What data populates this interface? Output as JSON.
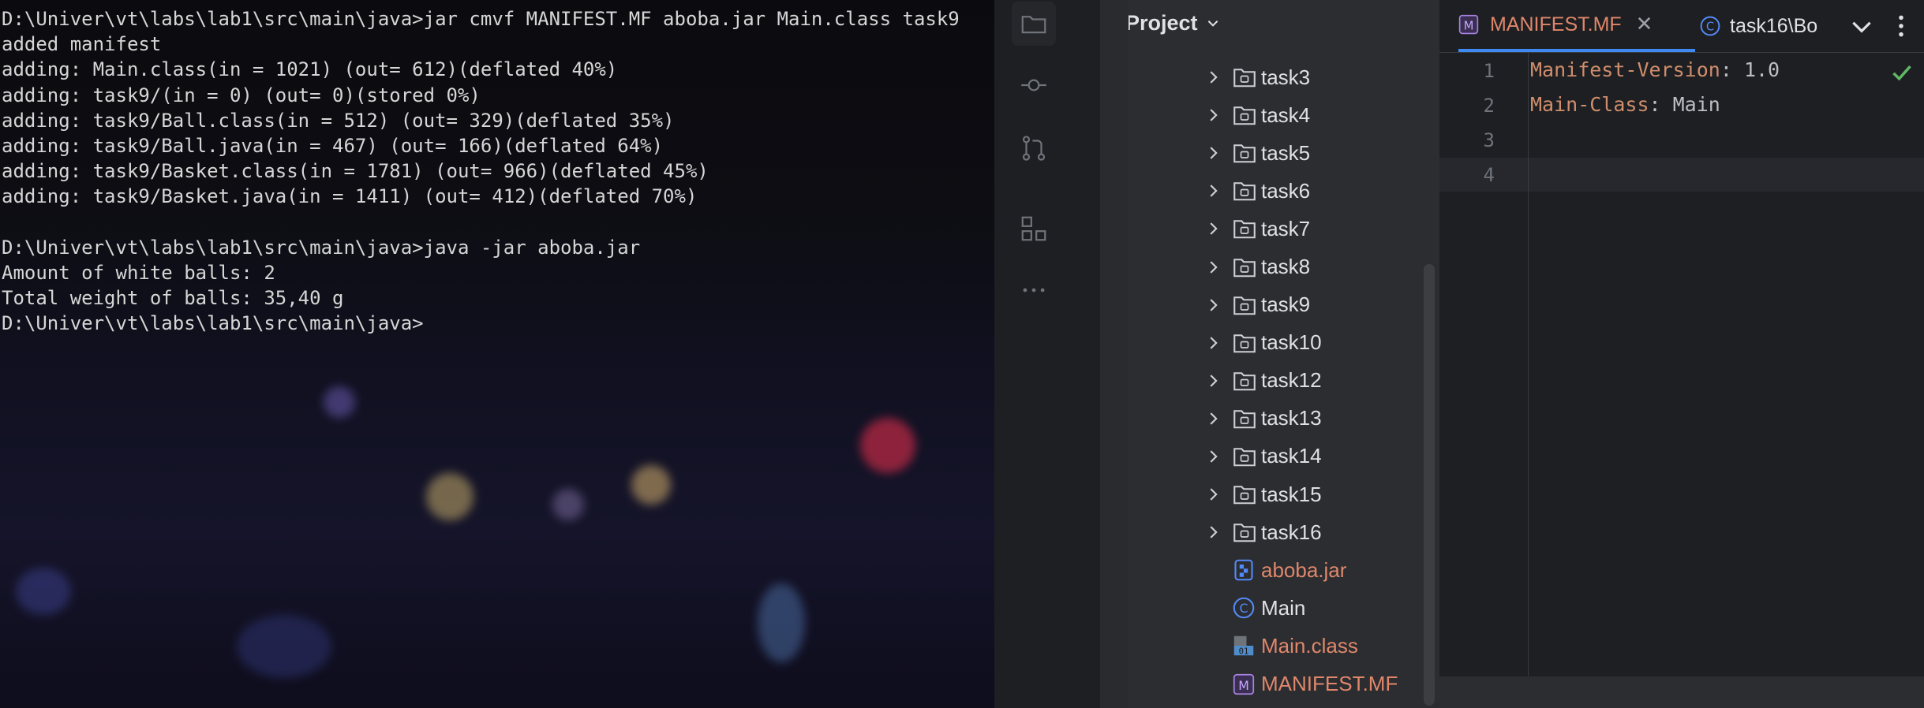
{
  "terminal": {
    "lines": [
      "D:\\Univer\\vt\\labs\\lab1\\src\\main\\java>jar cmvf MANIFEST.MF aboba.jar Main.class task9",
      "added manifest",
      "adding: Main.class(in = 1021) (out= 612)(deflated 40%)",
      "adding: task9/(in = 0) (out= 0)(stored 0%)",
      "adding: task9/Ball.class(in = 512) (out= 329)(deflated 35%)",
      "adding: task9/Ball.java(in = 467) (out= 166)(deflated 64%)",
      "adding: task9/Basket.class(in = 1781) (out= 966)(deflated 45%)",
      "adding: task9/Basket.java(in = 1411) (out= 412)(deflated 70%)",
      "",
      "D:\\Univer\\vt\\labs\\lab1\\src\\main\\java>java -jar aboba.jar",
      "Amount of white balls: 2",
      "Total weight of balls: 35,40 g",
      "D:\\Univer\\vt\\labs\\lab1\\src\\main\\java>"
    ]
  },
  "toolstrip": {
    "items": [
      {
        "name": "folder-icon"
      },
      {
        "name": "commit-icon"
      },
      {
        "name": "pull-requests-icon"
      },
      {
        "name": "structure-icon"
      },
      {
        "name": "more-icon"
      }
    ]
  },
  "project": {
    "title": "Project",
    "items": [
      {
        "label": "task3",
        "type": "folder"
      },
      {
        "label": "task4",
        "type": "folder"
      },
      {
        "label": "task5",
        "type": "folder"
      },
      {
        "label": "task6",
        "type": "folder"
      },
      {
        "label": "task7",
        "type": "folder"
      },
      {
        "label": "task8",
        "type": "folder"
      },
      {
        "label": "task9",
        "type": "folder"
      },
      {
        "label": "task10",
        "type": "folder"
      },
      {
        "label": "task12",
        "type": "folder"
      },
      {
        "label": "task13",
        "type": "folder"
      },
      {
        "label": "task14",
        "type": "folder"
      },
      {
        "label": "task15",
        "type": "folder"
      },
      {
        "label": "task16",
        "type": "folder"
      },
      {
        "label": "aboba.jar",
        "type": "jar"
      },
      {
        "label": "Main",
        "type": "class"
      },
      {
        "label": "Main.class",
        "type": "binary"
      },
      {
        "label": "MANIFEST.MF",
        "type": "manifest"
      }
    ]
  },
  "editor": {
    "tabs": [
      {
        "label": "MANIFEST.MF",
        "icon": "manifest-icon",
        "active": true
      },
      {
        "label": "task16\\Bo",
        "icon": "class-icon",
        "active": false
      }
    ],
    "line_numbers": [
      "1",
      "2",
      "3",
      "4"
    ],
    "lines": [
      {
        "key": "Manifest-Version",
        "sep": ": ",
        "value": "1.0"
      },
      {
        "key": "Main-Class",
        "sep": ": ",
        "value": "Main"
      },
      {
        "key": "",
        "sep": "",
        "value": ""
      },
      {
        "key": "",
        "sep": "",
        "value": ""
      }
    ]
  },
  "colors": {
    "accent": "#3d8bf2",
    "modified_file": "#e0876b",
    "success": "#5fb865"
  }
}
